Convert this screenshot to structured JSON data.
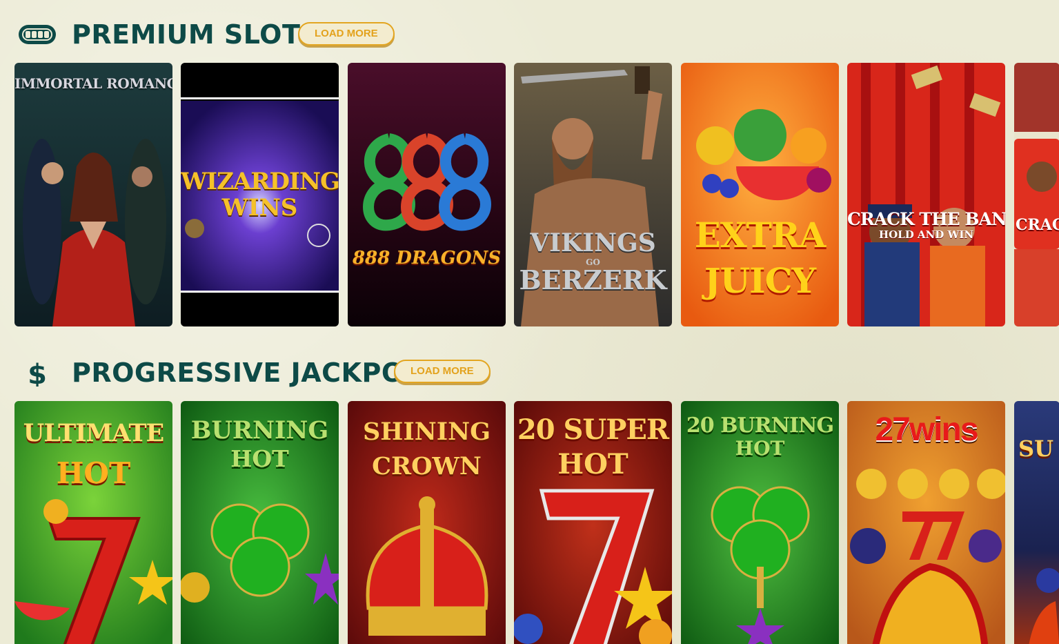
{
  "sections": [
    {
      "icon": "slot-machine-icon",
      "title": "PREMIUM SLOTS",
      "load_more": "LOAD MORE",
      "games": [
        {
          "title": "Immortal Romance"
        },
        {
          "title": "Wizarding Wins"
        },
        {
          "title": "888 Dragons"
        },
        {
          "title": "Vikings Go Berzerk"
        },
        {
          "title": "Extra Juicy"
        },
        {
          "title": "Crack the Bank Hold and Win"
        },
        {
          "title": "Crack"
        }
      ]
    },
    {
      "icon": "dollar-sign-icon",
      "title": "PROGRESSIVE JACKPOTS",
      "load_more": "LOAD MORE",
      "games": [
        {
          "title": "Ultimate Hot"
        },
        {
          "title": "Burning Hot"
        },
        {
          "title": "Shining Crown"
        },
        {
          "title": "20 Super Hot"
        },
        {
          "title": "20 Burning Hot"
        },
        {
          "title": "27 Wins"
        },
        {
          "title": "Su"
        }
      ]
    }
  ],
  "tile_art": {
    "immortal_romance": "IMMORTAL ROMANCE",
    "wizarding_1": "WIZARDING",
    "wizarding_2": "WINS",
    "dragons": "888 DRAGONS",
    "vikings_1": "VIKINGS",
    "vikings_go": "GO",
    "vikings_2": "BERZERK",
    "juicy_1": "EXTRA",
    "juicy_2": "JUICY",
    "crack_1": "CRACK THE BANK",
    "crack_2": "HOLD AND WIN",
    "crack_peek": "CRAC",
    "ultimate_1": "ULTIMATE",
    "ultimate_2": "HOT",
    "burning_1": "BURNING",
    "burning_2": "HOT",
    "shining_1": "SHINING",
    "shining_2": "CROWN",
    "super_1": "20 SUPER",
    "super_2": "HOT",
    "burning20_1": "20 BURNING",
    "burning20_2": "HOT",
    "wins27": "27wins",
    "su_peek": "SU"
  },
  "colors": {
    "title": "#0d4a47",
    "button_border": "#e3a520",
    "background": "#ecebd6"
  }
}
